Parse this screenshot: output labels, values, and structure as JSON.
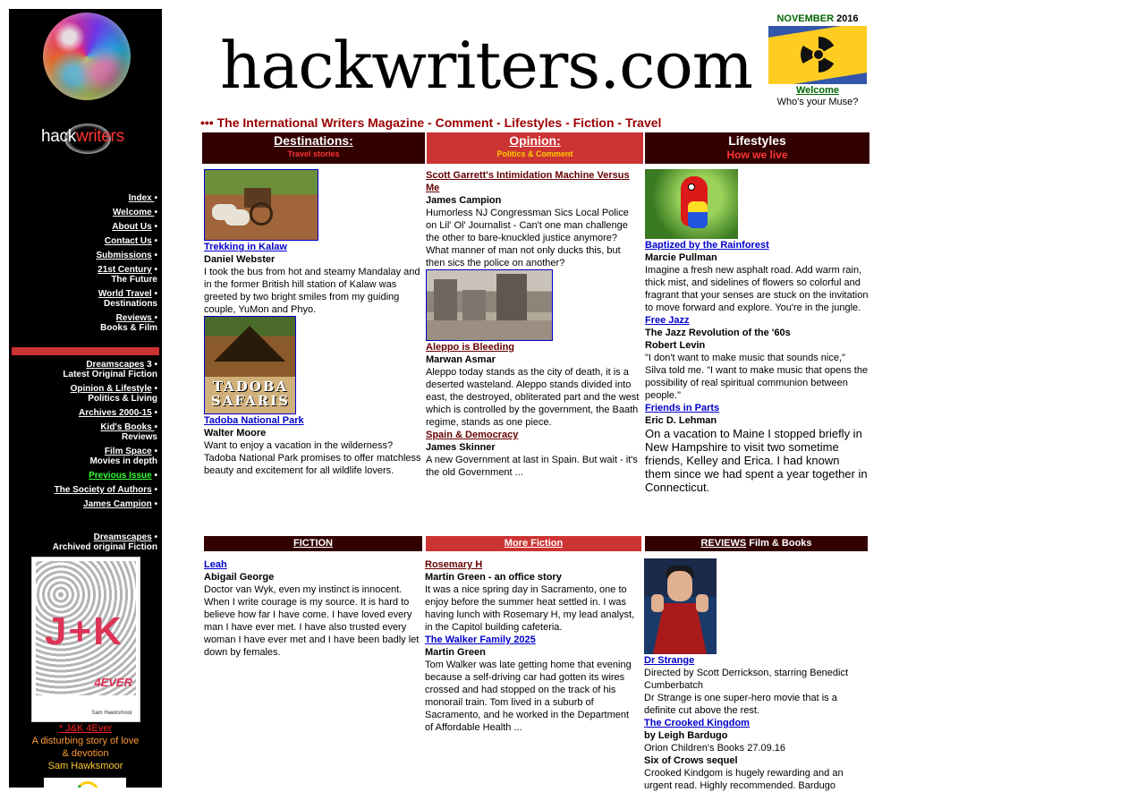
{
  "sidebar": {
    "brand_hack": "hack",
    "brand_writers": "writers",
    "nav": [
      {
        "label": "Index ",
        "sub": ""
      },
      {
        "label": "Welcome ",
        "sub": ""
      },
      {
        "label": "About Us",
        "sub": ""
      },
      {
        "label": "Contact Us",
        "sub": ""
      },
      {
        "label": "Submissions",
        "sub": ""
      },
      {
        "label": "21st Century",
        "sub": "The Future"
      },
      {
        "label": "World Travel",
        "sub": "Destinations"
      },
      {
        "label": "Reviews ",
        "sub": "Books & Film"
      }
    ],
    "nav2": [
      {
        "label": "Dreamscapes",
        "count": " 3",
        "sub": "Latest Original Fiction"
      },
      {
        "label": "Opinion & Lifestyle",
        "count": "",
        "sub": "Politics & Living"
      },
      {
        "label": "Archives 2000-15",
        "count": "",
        "sub": ""
      },
      {
        "label": "Kid's Books ",
        "count": "",
        "sub": "Reviews"
      },
      {
        "label": "Film Space",
        "count": "",
        "sub": "Movies in depth"
      },
      {
        "label": "Previous Issue",
        "count": "",
        "sub": ""
      },
      {
        "label": "The Society of Authors",
        "count": "",
        "sub": ""
      },
      {
        "label": "James Campion",
        "count": "",
        "sub": ""
      }
    ],
    "nav3": {
      "label": "Dreamscapes",
      "sub": "Archived original Fiction"
    },
    "bullet": " •",
    "book": {
      "cover_title": "J+K",
      "cover_forever": "4EVER",
      "cover_author": "Sam Hawksmoor",
      "caption_title": "* J&K 4Ever ",
      "caption_line1": "A disturbing story of love",
      "caption_line2": "& devotion",
      "caption_author": "Sam Hawksmoor"
    }
  },
  "masthead": {
    "title": "hackwriters.com",
    "issue_month": "NOVEMBER",
    "issue_year": " 2016",
    "welcome_link": "Welcome",
    "welcome_sub": "Who's your Muse?",
    "tagline": "••• The International Writers Magazine - Comment - Lifestyles - Fiction - Travel"
  },
  "sections": {
    "destinations": {
      "title": "Destinations:",
      "sub": "Travel stories"
    },
    "opinion": {
      "title": "Opinion:",
      "sub": "Politics & Comment"
    },
    "lifestyles": {
      "title": "Lifestyles",
      "sub": "How we live"
    }
  },
  "destinations": [
    {
      "title": "Trekking in Kalaw",
      "author": "Daniel Webster",
      "desc": "I took the bus from hot and steamy Mandalay and in the former British hill station of Kalaw was greeted by two bright smiles from my guiding couple, YuMon and Phyo."
    },
    {
      "title": "Tadoba National Park ",
      "author": "Walter Moore",
      "desc": "Want to enjoy a vacation in the wilderness? Tadoba National Park promises to offer matchless beauty and excitement for all wildlife lovers.",
      "img_text": "TADOBA SAFARIS"
    }
  ],
  "opinion": [
    {
      "title": "Scott Garrett's Intimidation Machine Versus Me ",
      "author": "James Campion",
      "desc": "Humorless NJ Congressman Sics Local Police on Lil' Ol' Journalist - Can't one man challenge the other to bare-knuckled justice anymore? What manner of man not only ducks this, but then sics the police on another?"
    },
    {
      "title": "Aleppo is Bleeding",
      "author": "Marwan Asmar",
      "desc": "Aleppo today stands as the city of death, it is a deserted wasteland. Aleppo stands divided into east, the destroyed, obliterated part and the west which is controlled by the government, the Baath regime, stands as one piece."
    },
    {
      "title": "Spain & Democracy ",
      "author": "James Skinner",
      "desc": "A new Government at last in Spain. But wait - it's the old Government ..."
    }
  ],
  "lifestyles": [
    {
      "title": "Baptized by the Rainforest ",
      "author": "Marcie Pullman",
      "desc": "Imagine a fresh new asphalt road. Add warm rain, thick mist, and sidelines of flowers so colorful and fragrant that your senses are stuck on the invitation to move forward and explore. You're in the jungle."
    },
    {
      "title": "Free Jazz ",
      "subtitle": "The Jazz Revolution of the '60s",
      "author": "Robert Levin",
      "desc": "\"I don't want to make music that sounds nice,\" Silva told me. \"I want to make music that opens the possibility of real spiritual communion between people.\""
    },
    {
      "title": "Friends in Parts",
      "author": "Eric D. Lehman",
      "desc": "On a vacation to Maine I stopped briefly in New Hampshire to visit two sometime friends, Kelley and Erica. I had known them since we had spent a year together in Connecticut."
    }
  ],
  "bars": {
    "fiction": "FICTION",
    "more_fiction": "More Fiction",
    "reviews_u": "REVIEWS",
    "reviews_rest": " Film & Books"
  },
  "fiction": [
    {
      "title": "Leah",
      "author": "Abigail George",
      "desc": "Doctor van Wyk, even my instinct is innocent. When I write courage is my source. It is hard to believe how far I have come. I have loved every man I have ever met. I have also trusted every woman I have ever met and I have been badly let down by females."
    }
  ],
  "more_fiction": [
    {
      "title": "Rosemary H",
      "author": "Martin Green - an office story",
      "desc": "It was a nice spring day in Sacramento, one to enjoy before the summer heat settled in.  I was having lunch with Rosemary H, my lead analyst, in the Capitol building cafeteria."
    },
    {
      "title": "The Walker Family 2025 ",
      "author": "Martin Green",
      "desc": "Tom Walker was late getting home that evening because a self-driving car had gotten its wires crossed and had stopped on the track of his monorail train.  Tom lived in a suburb of Sacramento, and he worked in the Department of Affordable Health ..."
    }
  ],
  "reviews": [
    {
      "title": "Dr Strange",
      "line1": "Directed by Scott Derrickson, starring Benedict Cumberbatch",
      "desc": "Dr Strange is one super-hero movie that is a definite cut above the rest."
    },
    {
      "title": "The Crooked Kingdom ",
      "author": "by Leigh Bardugo",
      "line1": "Orion Children's Books 27.09.16",
      "subtitle": "Six of Crows sequel",
      "desc": "Crooked Kindgom is hugely rewarding and an urgent read. Highly recommended. Bardugo"
    }
  ],
  "colors": {
    "dark_red": "#330000",
    "red": "#cc3333",
    "link": "#0000cc",
    "tagline": "#990000",
    "green": "#006600"
  }
}
